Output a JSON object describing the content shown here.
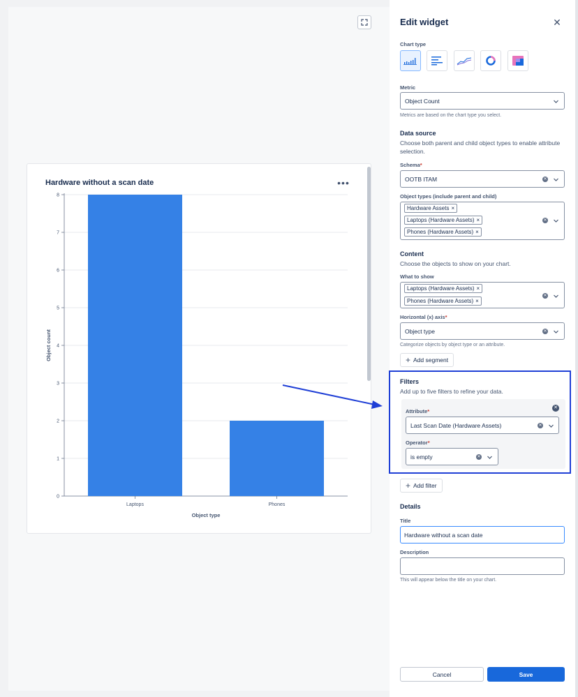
{
  "chart": {
    "title": "Hardware without a scan date",
    "more_icon": "ellipsis-icon",
    "expand_icon": "expand-icon"
  },
  "chart_data": {
    "type": "bar",
    "categories": [
      "Laptops",
      "Phones"
    ],
    "values": [
      8,
      2
    ],
    "xlabel": "Object type",
    "ylabel": "Object count",
    "ylim": [
      0,
      8
    ],
    "yticks": [
      "0",
      "1",
      "2",
      "3",
      "4",
      "5",
      "6",
      "7",
      "8"
    ],
    "bar_color": "#3581e6",
    "grid": true
  },
  "panel": {
    "title": "Edit widget",
    "close_icon": "close-icon",
    "chart_type_label": "Chart type",
    "chart_types": [
      "bar-chart-icon",
      "horizontal-bar-chart-icon",
      "line-chart-icon",
      "donut-chart-icon",
      "layout-chart-icon"
    ],
    "metric": {
      "label": "Metric",
      "value": "Object Count",
      "hint": "Metrics are based on the chart type you select."
    },
    "data_source": {
      "heading": "Data source",
      "description": "Choose both parent and child object types to enable attribute selection.",
      "schema_label": "Schema",
      "schema_value": "OOTB ITAM",
      "object_types_label": "Object types (include parent and child)",
      "object_types": [
        "Hardware Assets",
        "Laptops (Hardware Assets)",
        "Phones (Hardware Assets)"
      ]
    },
    "content": {
      "heading": "Content",
      "description": "Choose the objects to show on your chart.",
      "what_label": "What to show",
      "what_values": [
        "Laptops (Hardware Assets)",
        "Phones (Hardware Assets)"
      ],
      "axis_label": "Horizontal (x) axis",
      "axis_value": "Object type",
      "axis_hint": "Categorize objects by object type or an attribute.",
      "add_segment": "Add segment"
    },
    "filters": {
      "heading": "Filters",
      "description": "Add up to five filters to refine your data.",
      "attribute_label": "Attribute",
      "attribute_value": "Last Scan Date (Hardware Assets)",
      "operator_label": "Operator",
      "operator_value": "is empty",
      "add_filter": "Add filter"
    },
    "details": {
      "heading": "Details",
      "title_label": "Title",
      "title_value": "Hardware without a scan date",
      "description_label": "Description",
      "description_value": "",
      "description_hint": "This will appear below the title on your chart."
    },
    "cancel": "Cancel",
    "save": "Save",
    "required_mark": "*",
    "remove_mark": "×",
    "plus_mark": "+"
  },
  "colors": {
    "accent": "#1868db",
    "annotation": "#1f3fd6",
    "bar": "#3581e6"
  }
}
